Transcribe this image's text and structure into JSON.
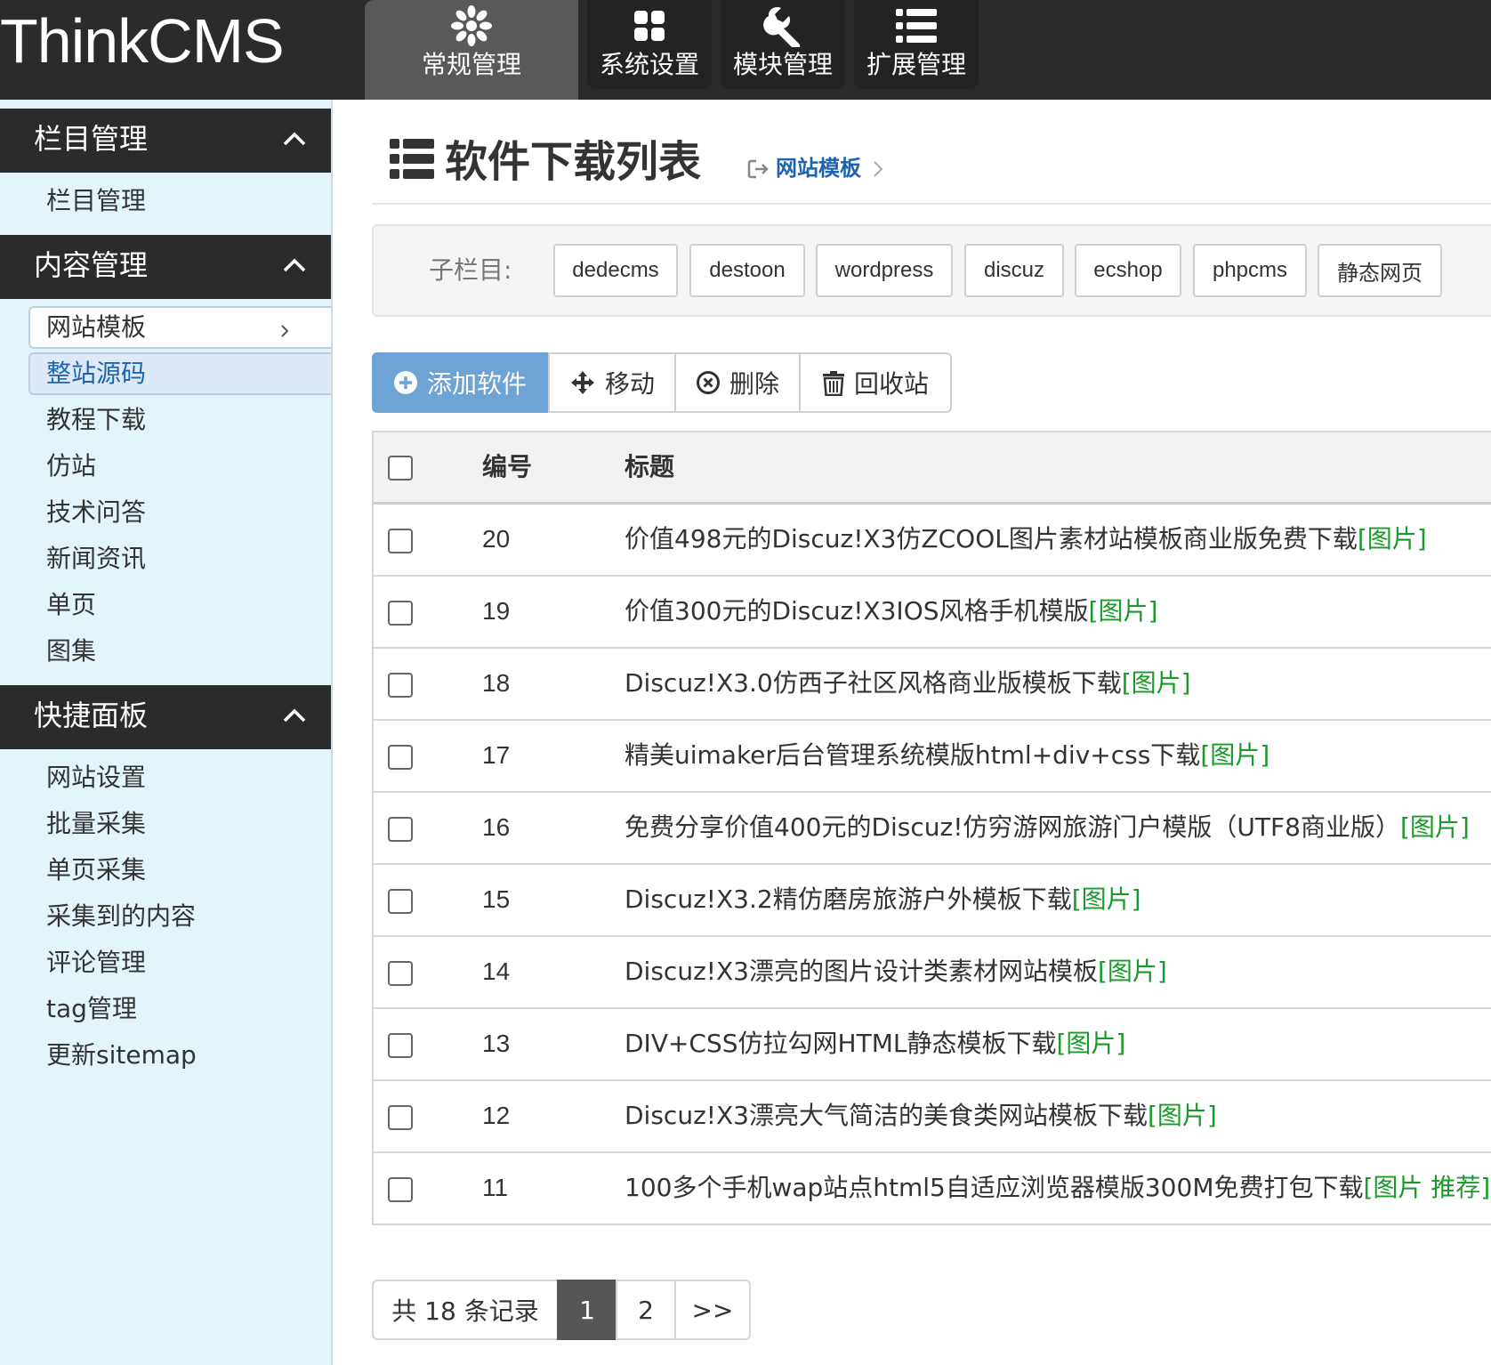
{
  "app": {
    "logo": "ThinkCMS"
  },
  "topnav": [
    {
      "label": "常规管理",
      "icon": "flower-icon",
      "active": true
    },
    {
      "label": "系统设置",
      "icon": "grid-icon",
      "active": false
    },
    {
      "label": "模块管理",
      "icon": "wrench-icon",
      "active": false
    },
    {
      "label": "扩展管理",
      "icon": "list-icon",
      "active": false
    }
  ],
  "sidebar": {
    "sections": [
      {
        "title": "栏目管理",
        "items": [
          "栏目管理"
        ]
      },
      {
        "title": "内容管理",
        "items": [
          "网站模板",
          "整站源码",
          "教程下载",
          "仿站",
          "技术问答",
          "新闻资讯",
          "单页",
          "图集"
        ]
      },
      {
        "title": "快捷面板",
        "items": [
          "网站设置",
          "批量采集",
          "单页采集",
          "采集到的内容",
          "评论管理",
          "tag管理",
          "更新sitemap"
        ]
      }
    ]
  },
  "main": {
    "title": "软件下载列表",
    "breadcrumb": "网站模板",
    "subcategory_label": "子栏目:",
    "subcategories": [
      "dedecms",
      "destoon",
      "wordpress",
      "discuz",
      "ecshop",
      "phpcms",
      "静态网页"
    ],
    "toolbar": {
      "add": "添加软件",
      "move": "移动",
      "delete": "删除",
      "recycle": "回收站"
    },
    "table": {
      "headers": {
        "id": "编号",
        "title": "标题"
      },
      "rows": [
        {
          "id": "20",
          "title": "价值498元的Discuz!X3仿ZCOOL图片素材站模板商业版免费下载",
          "tag": "[图片]"
        },
        {
          "id": "19",
          "title": "价值300元的Discuz!X3IOS风格手机模版",
          "tag": "[图片]"
        },
        {
          "id": "18",
          "title": "Discuz!X3.0仿西子社区风格商业版模板下载",
          "tag": "[图片]"
        },
        {
          "id": "17",
          "title": "精美uimaker后台管理系统模版html+div+css下载",
          "tag": "[图片]"
        },
        {
          "id": "16",
          "title": "免费分享价值400元的Discuz!仿穷游网旅游门户模版（UTF8商业版）",
          "tag": "[图片]"
        },
        {
          "id": "15",
          "title": "Discuz!X3.2精仿磨房旅游户外模板下载",
          "tag": "[图片]"
        },
        {
          "id": "14",
          "title": "Discuz!X3漂亮的图片设计类素材网站模板",
          "tag": "[图片]"
        },
        {
          "id": "13",
          "title": "DIV+CSS仿拉勾网HTML静态模板下载",
          "tag": "[图片]"
        },
        {
          "id": "12",
          "title": "Discuz!X3漂亮大气简洁的美食类网站模板下载",
          "tag": "[图片]"
        },
        {
          "id": "11",
          "title": "100多个手机wap站点html5自适应浏览器模版300M免费打包下载",
          "tag": "[图片 推荐]"
        }
      ]
    },
    "pagination": {
      "summary": "共 18 条记录",
      "pages": [
        "1",
        "2"
      ],
      "current": "1",
      "next": ">>"
    }
  },
  "colors": {
    "topbar": "#2b2b2b",
    "sidebar_bg": "#e3f4fb",
    "primary_button": "#6ea3d6",
    "tag_green": "#1a9a2a",
    "link_blue": "#1e63b0"
  }
}
